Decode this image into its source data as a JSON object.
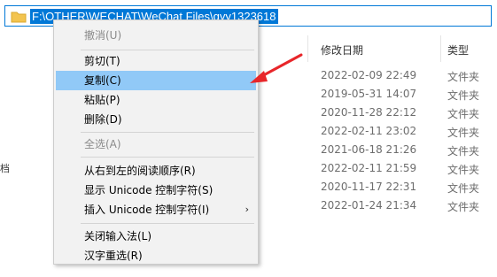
{
  "address_bar": {
    "path": "F:\\OTHER\\WECHAT\\WeChat Files\\qyy1323618"
  },
  "columns": {
    "date": "修改日期",
    "type": "类型"
  },
  "rows": [
    {
      "date": "2022-02-09 22:49",
      "type": "文件夹"
    },
    {
      "date": "2019-05-31 14:07",
      "type": "文件夹"
    },
    {
      "date": "2020-11-28 22:12",
      "type": "文件夹"
    },
    {
      "date": "2022-02-11 23:02",
      "type": "文件夹"
    },
    {
      "date": "2021-06-18 21:26",
      "type": "文件夹"
    },
    {
      "date": "2022-02-11 21:59",
      "type": "文件夹"
    },
    {
      "date": "2020-11-17 22:31",
      "type": "文件夹"
    },
    {
      "date": "2022-01-24 21:34",
      "type": "文件夹"
    }
  ],
  "left_fragment": "档",
  "context_menu": {
    "undo": "撤消(U)",
    "cut": "剪切(T)",
    "copy": "复制(C)",
    "paste": "粘贴(P)",
    "delete": "删除(D)",
    "select_all": "全选(A)",
    "rtl": "从右到左的阅读顺序(R)",
    "show_unicode": "显示 Unicode 控制字符(S)",
    "insert_unicode": "插入 Unicode 控制字符(I)",
    "close_ime": "关闭输入法(L)",
    "reconvert": "汉字重选(R)"
  },
  "colors": {
    "selection": "#0078d7",
    "menu_highlight": "#91c9f7",
    "annotation": "#e8262a"
  }
}
